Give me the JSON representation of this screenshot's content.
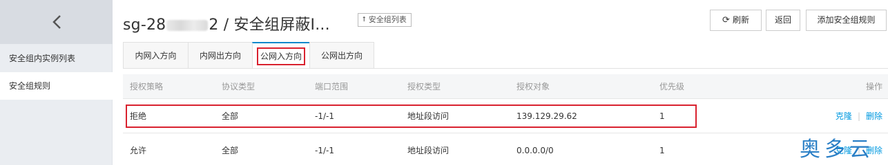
{
  "sidebar": {
    "items": [
      {
        "label": "安全组内实例列表"
      },
      {
        "label": "安全组规则"
      }
    ]
  },
  "header": {
    "title_prefix": "sg-28",
    "title_suffix": "2 / 安全组屏蔽I...",
    "sg_list_label": "安全组列表",
    "refresh_label": "刷新",
    "back_label": "返回",
    "add_rule_label": "添加安全组规则"
  },
  "tabs": [
    {
      "label": "内网入方向"
    },
    {
      "label": "内网出方向"
    },
    {
      "label": "公网入方向"
    },
    {
      "label": "公网出方向"
    }
  ],
  "table": {
    "columns": [
      "授权策略",
      "协议类型",
      "端口范围",
      "授权类型",
      "授权对象",
      "优先级",
      "操作"
    ],
    "rows": [
      {
        "policy": "拒绝",
        "protocol": "全部",
        "port": "-1/-1",
        "auth_type": "地址段访问",
        "target": "139.129.29.62",
        "priority": "1",
        "clone": "克隆",
        "delete": "删除"
      },
      {
        "policy": "允许",
        "protocol": "全部",
        "port": "-1/-1",
        "auth_type": "地址段访问",
        "target": "0.0.0.0/0",
        "priority": "1",
        "clone": "克隆",
        "delete": "删除"
      }
    ]
  },
  "watermark": "奥多云",
  "colors": {
    "highlight": "#d9212e",
    "link": "#0099e0",
    "active_tab": "#0088cc"
  }
}
